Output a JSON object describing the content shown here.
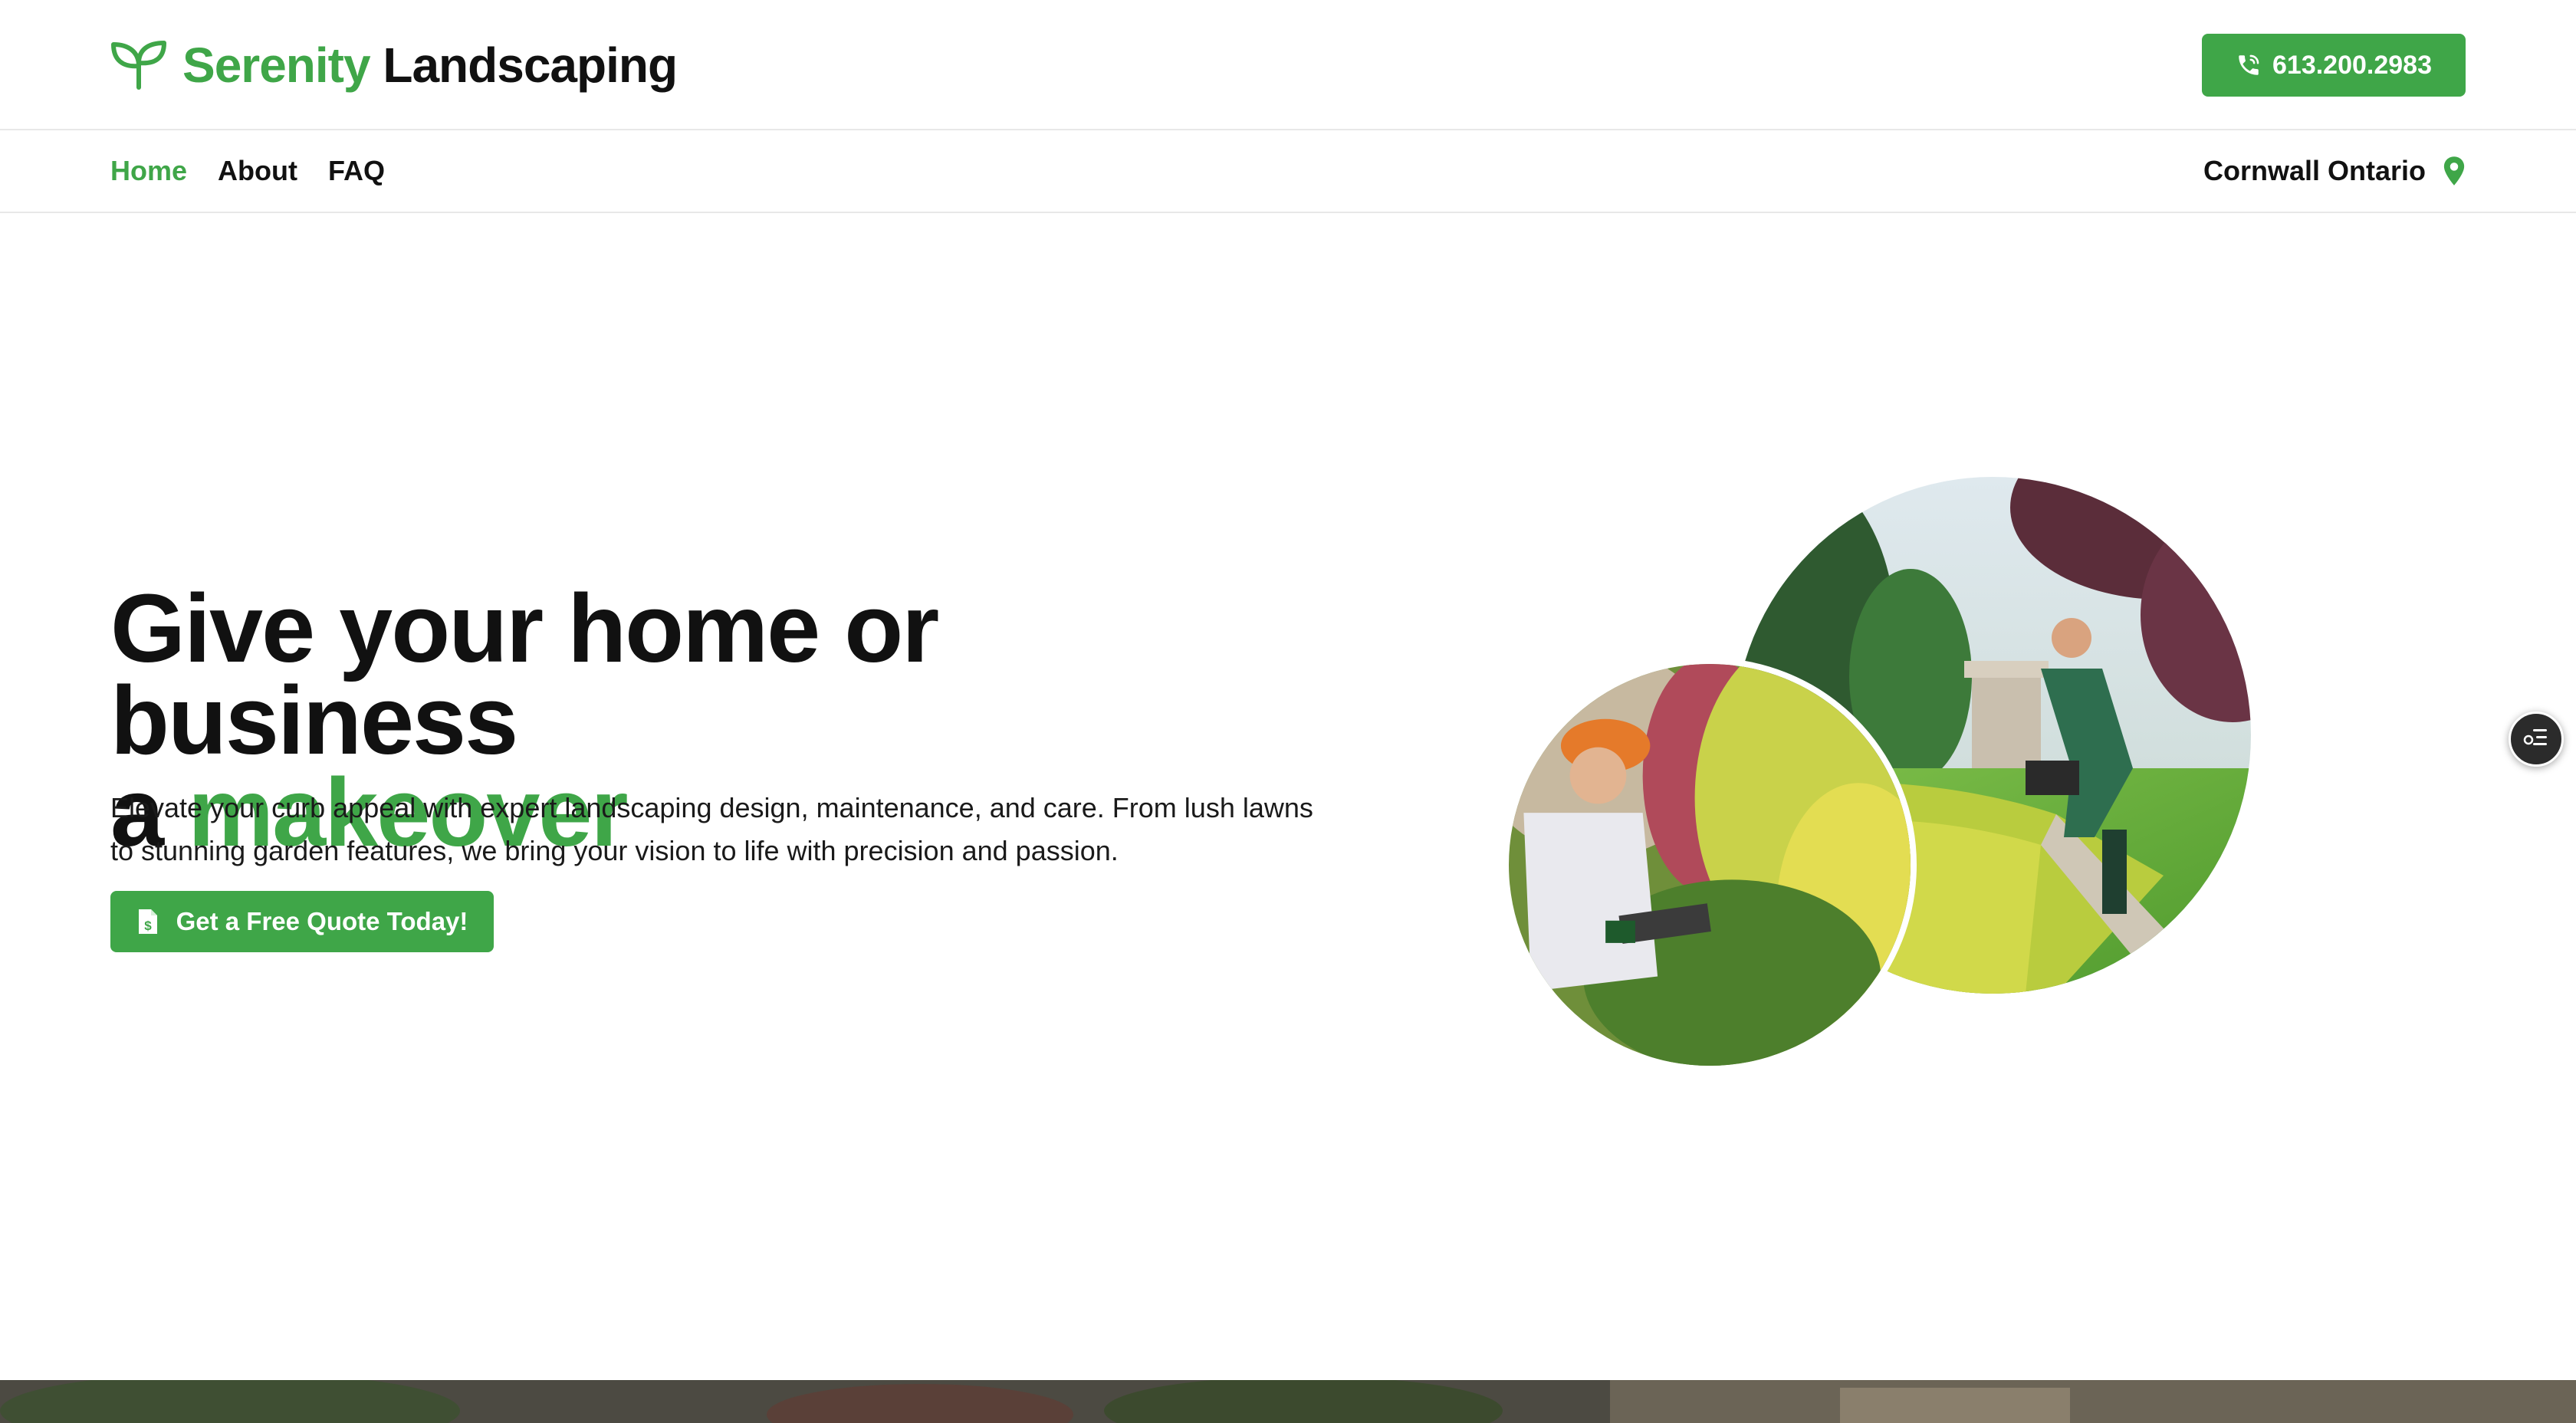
{
  "header": {
    "brand_green": "Serenity",
    "brand_dark": "Landscaping",
    "phone": "613.200.2983"
  },
  "nav": {
    "items": [
      {
        "label": "Home",
        "active": true
      },
      {
        "label": "About",
        "active": false
      },
      {
        "label": "FAQ",
        "active": false
      }
    ],
    "location": "Cornwall Ontario"
  },
  "hero": {
    "title_line1": "Give your home or business",
    "title_prefix": "a",
    "title_highlight": "makeover",
    "description": "Elevate your curb appeal with expert landscaping design, maintenance, and care. From lush lawns to stunning garden features, we bring your vision to life with precision and passion.",
    "cta_label": "Get a Free Quote Today!"
  },
  "icons": {
    "brand": "sprout-icon",
    "phone": "phone-icon",
    "location": "map-pin-icon",
    "cta": "dollar-document-icon",
    "widget": "accessibility-settings-icon"
  },
  "colors": {
    "accent": "#3fa648",
    "text": "#111111",
    "background": "#ffffff",
    "widget": "#2b2b2b"
  }
}
